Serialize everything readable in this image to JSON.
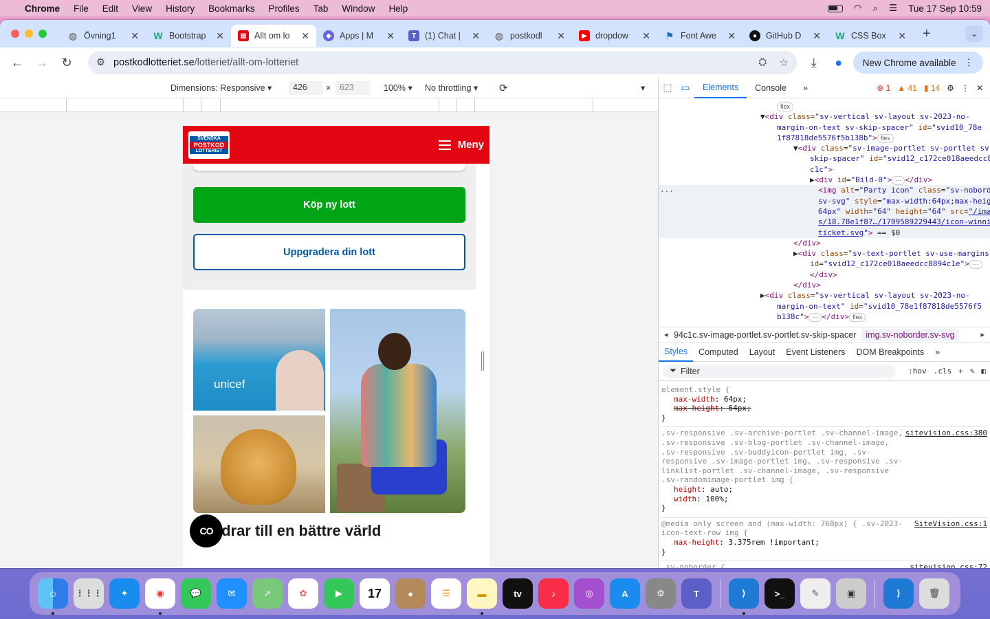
{
  "menubar": {
    "app": "Chrome",
    "items": [
      "File",
      "Edit",
      "View",
      "History",
      "Bookmarks",
      "Profiles",
      "Tab",
      "Window",
      "Help"
    ],
    "datetime": "Tue 17 Sep  10:59"
  },
  "tabs": [
    {
      "title": "Övning1",
      "fav": "globe"
    },
    {
      "title": "Bootstrap",
      "fav": "W"
    },
    {
      "title": "Allt om lo",
      "fav": "lotteriet"
    },
    {
      "title": "Apps | M",
      "fav": "apps"
    },
    {
      "title": "(1) Chat |",
      "fav": "teams"
    },
    {
      "title": "postkodl",
      "fav": "globe"
    },
    {
      "title": "dropdow",
      "fav": "youtube"
    },
    {
      "title": "Font Awe",
      "fav": "flag"
    },
    {
      "title": "GitHub D",
      "fav": "github"
    },
    {
      "title": "CSS Box",
      "fav": "W"
    }
  ],
  "address": {
    "host": "postkodlotteriet.se",
    "path": "/lotteriet/allt-om-lotteriet"
  },
  "new_chrome": "New Chrome available",
  "device_bar": {
    "dimensions": "Dimensions: Responsive",
    "width": "426",
    "height": "623",
    "zoom": "100%",
    "throttle": "No throttling"
  },
  "site": {
    "logo": [
      "SVENSKA",
      "POSTKOD",
      "LOTTERIET"
    ],
    "menu_label": "Meny",
    "buy_button": "Köp ny lott",
    "upgrade_button": "Uppgradera din lott",
    "unicef": "unicef",
    "headline": "bidrar till en bättre värld",
    "chat_badge": "CO"
  },
  "devtools": {
    "tabs": [
      "Elements",
      "Console"
    ],
    "errors": "1",
    "warnings": "41",
    "issues": "14",
    "dom_lines": [
      {
        "indent": 14,
        "parts": [
          [
            "pill",
            "flex"
          ]
        ]
      },
      {
        "indent": 12,
        "parts": [
          [
            "plain",
            "▼"
          ],
          [
            "tg",
            "<div "
          ],
          [
            "an",
            "class"
          ],
          [
            "plain",
            "="
          ],
          [
            "av",
            "\"sv-vertical sv-layout sv-2023-no-"
          ]
        ]
      },
      {
        "indent": 14,
        "parts": [
          [
            "av",
            "margin-on-text sv-skip-spacer\" "
          ],
          [
            "an",
            "id"
          ],
          [
            "plain",
            "="
          ],
          [
            "av",
            "\"svid10_78e"
          ]
        ]
      },
      {
        "indent": 14,
        "parts": [
          [
            "av",
            "1f87818de5576f5b138b\""
          ],
          [
            "tg",
            ">"
          ],
          [
            "pill",
            "flex"
          ]
        ]
      },
      {
        "indent": 16,
        "parts": [
          [
            "plain",
            "▼"
          ],
          [
            "tg",
            "<div "
          ],
          [
            "an",
            "class"
          ],
          [
            "plain",
            "="
          ],
          [
            "av",
            "\"sv-image-portlet sv-portlet sv-"
          ]
        ]
      },
      {
        "indent": 18,
        "parts": [
          [
            "av",
            "skip-spacer\" "
          ],
          [
            "an",
            "id"
          ],
          [
            "plain",
            "="
          ],
          [
            "av",
            "\"svid12_c172ce018aeedcc8894"
          ]
        ]
      },
      {
        "indent": 18,
        "parts": [
          [
            "av",
            "c1c\""
          ],
          [
            "tg",
            ">"
          ]
        ]
      },
      {
        "indent": 18,
        "parts": [
          [
            "plain",
            "▶"
          ],
          [
            "tg",
            "<div "
          ],
          [
            "an",
            "id"
          ],
          [
            "plain",
            "="
          ],
          [
            "av",
            "\"Bild-0\""
          ],
          [
            "tg",
            ">"
          ],
          [
            "pill",
            "···"
          ],
          [
            "tg",
            "</div>"
          ]
        ]
      },
      {
        "indent": 19,
        "sel": true,
        "parts": [
          [
            "tg",
            "<img "
          ],
          [
            "an",
            "alt"
          ],
          [
            "plain",
            "="
          ],
          [
            "av",
            "\"Party icon\" "
          ],
          [
            "an",
            "class"
          ],
          [
            "plain",
            "="
          ],
          [
            "av",
            "\"sv-noborder"
          ]
        ]
      },
      {
        "indent": 19,
        "sel": true,
        "parts": [
          [
            "av",
            "sv-svg\" "
          ],
          [
            "an",
            "style"
          ],
          [
            "plain",
            "="
          ],
          [
            "av",
            "\"max-width:64px;max-height:"
          ]
        ]
      },
      {
        "indent": 19,
        "sel": true,
        "parts": [
          [
            "av",
            "64px\" "
          ],
          [
            "an",
            "width"
          ],
          [
            "plain",
            "="
          ],
          [
            "av",
            "\"64\" "
          ],
          [
            "an",
            "height"
          ],
          [
            "plain",
            "="
          ],
          [
            "av",
            "\"64\" "
          ],
          [
            "an",
            "src"
          ],
          [
            "plain",
            "="
          ],
          [
            "lk",
            "\"/image"
          ]
        ]
      },
      {
        "indent": 19,
        "sel": true,
        "parts": [
          [
            "lk",
            "s/18.78e1f87…/1709589229443/icon-winning-"
          ]
        ]
      },
      {
        "indent": 19,
        "sel": true,
        "parts": [
          [
            "lk",
            "ticket.svg"
          ],
          [
            "av",
            "\""
          ],
          [
            "tg",
            ">"
          ],
          [
            "plain",
            " == $0"
          ]
        ]
      },
      {
        "indent": 16,
        "parts": [
          [
            "tg",
            "</div>"
          ]
        ]
      },
      {
        "indent": 16,
        "parts": [
          [
            "plain",
            "▶"
          ],
          [
            "tg",
            "<div "
          ],
          [
            "an",
            "class"
          ],
          [
            "plain",
            "="
          ],
          [
            "av",
            "\"sv-text-portlet sv-use-margins\""
          ]
        ]
      },
      {
        "indent": 18,
        "parts": [
          [
            "an",
            "id"
          ],
          [
            "plain",
            "="
          ],
          [
            "av",
            "\"svid12_c172ce018aeedcc8894c1e\""
          ],
          [
            "tg",
            ">"
          ],
          [
            "pill",
            "···"
          ]
        ]
      },
      {
        "indent": 18,
        "parts": [
          [
            "tg",
            "</div>"
          ]
        ]
      },
      {
        "indent": 16,
        "parts": [
          [
            "tg",
            "</div>"
          ]
        ]
      },
      {
        "indent": 12,
        "parts": [
          [
            "plain",
            "▶"
          ],
          [
            "tg",
            "<div "
          ],
          [
            "an",
            "class"
          ],
          [
            "plain",
            "="
          ],
          [
            "av",
            "\"sv-vertical sv-layout sv-2023-no-"
          ]
        ]
      },
      {
        "indent": 14,
        "parts": [
          [
            "av",
            "margin-on-text\" "
          ],
          [
            "an",
            "id"
          ],
          [
            "plain",
            "="
          ],
          [
            "av",
            "\"svid10_78e1f87818de5576f5"
          ]
        ]
      },
      {
        "indent": 14,
        "parts": [
          [
            "av",
            "b138c\""
          ],
          [
            "tg",
            ">"
          ],
          [
            "pill",
            "···"
          ],
          [
            "tg",
            "</div>"
          ],
          [
            "pill",
            "flex"
          ]
        ]
      }
    ],
    "breadcrumb_1": "94c1c.sv-image-portlet.sv-portlet.sv-skip-spacer",
    "breadcrumb_2": "img.sv-noborder.sv-svg",
    "style_tabs": [
      "Styles",
      "Computed",
      "Layout",
      "Event Listeners",
      "DOM Breakpoints"
    ],
    "filter_placeholder": "Filter",
    "filter_opts": [
      ":hov",
      ".cls"
    ],
    "rules": [
      {
        "selector": "element.style {",
        "source": "",
        "props": [
          [
            "max-width",
            "64px",
            false
          ],
          [
            "max-height",
            "64px",
            true
          ]
        ]
      },
      {
        "selector": ".sv-responsive .sv-archive-portlet .sv-channel-image, .sv-responsive .sv-blog-portlet .sv-channel-image, .sv-responsive .sv-buddyicon-portlet img, .sv-responsive .sv-image-portlet img, .sv-responsive .sv-linklist-portlet .sv-channel-image, .sv-responsive .sv-randomimage-portlet img {",
        "source": "sitevision.css:380",
        "props": [
          [
            "height",
            "auto",
            false
          ],
          [
            "width",
            "100%",
            false
          ]
        ]
      },
      {
        "selector": "@media only screen and (max-width: 768px) {  .sv-2023-icon-text-row img {",
        "source": "SiteVision.css:1",
        "props": [
          [
            "max-height",
            "3.375rem !important",
            false
          ]
        ]
      },
      {
        "selector": ".sv-noborder {",
        "source": "sitevision.css:72",
        "props": []
      }
    ]
  }
}
